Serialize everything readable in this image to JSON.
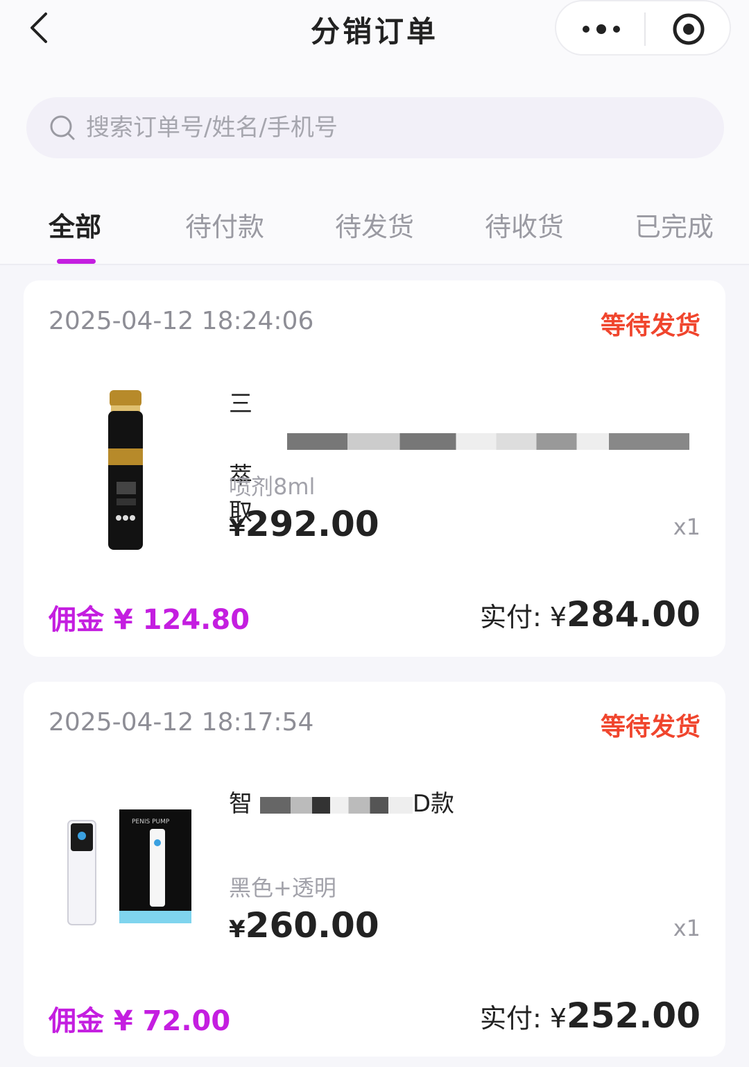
{
  "nav": {
    "title": "分销订单",
    "back_icon": "chevron-left-icon",
    "more_icon": "more-dots-icon",
    "target_icon": "target-icon"
  },
  "search": {
    "placeholder": "搜索订单号/姓名/手机号",
    "value": ""
  },
  "tabs": [
    {
      "label": "全部",
      "active": true
    },
    {
      "label": "待付款",
      "active": false
    },
    {
      "label": "待发货",
      "active": false
    },
    {
      "label": "待收货",
      "active": false
    },
    {
      "label": "已完成",
      "active": false
    }
  ],
  "colors": {
    "accent": "#c41ee0",
    "status": "#f0452d"
  },
  "orders": [
    {
      "time": "2025-04-12 18:24:06",
      "status": "等待发货",
      "product_name_start": "三",
      "product_name_end": "萃",
      "product_name_line2": "取",
      "spec": "喷剂8ml",
      "currency": "¥",
      "price": "292.00",
      "qty": "x1",
      "commission": "佣金 ¥ 124.80",
      "paid_label": "实付: ¥",
      "paid": "284.00"
    },
    {
      "time": "2025-04-12 18:17:54",
      "status": "等待发货",
      "product_name_start": "智",
      "product_name_end": "D款",
      "spec": "黑色+透明",
      "currency": "¥",
      "price": "260.00",
      "qty": "x1",
      "commission": "佣金 ¥ 72.00",
      "paid_label": "实付: ¥",
      "paid": "252.00"
    }
  ]
}
